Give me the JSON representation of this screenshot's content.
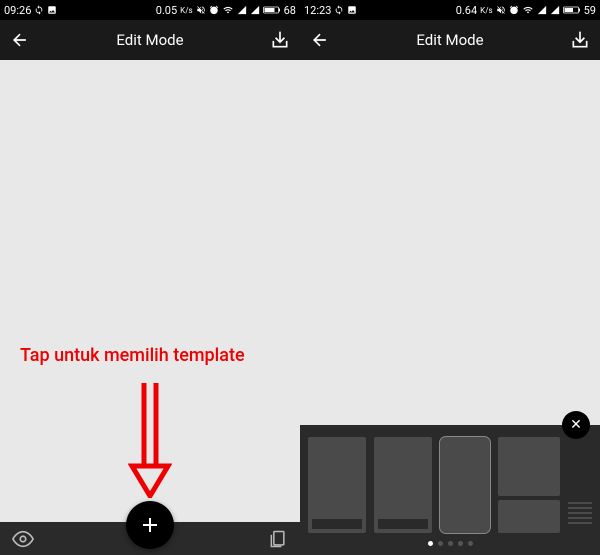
{
  "left_screen": {
    "status": {
      "time": "09:26",
      "net_speed": "0.05",
      "net_unit": "K/s",
      "battery": "68"
    },
    "header": {
      "title": "Edit Mode"
    }
  },
  "right_screen": {
    "status": {
      "time": "12:23",
      "net_speed": "0.64",
      "net_unit": "K/s",
      "battery": "59"
    },
    "header": {
      "title": "Edit Mode"
    },
    "template_panel": {
      "close_label": "✕",
      "page_count": 5,
      "active_page": 0
    }
  },
  "fab": {
    "plus_label": "+"
  },
  "annotation": {
    "text": "Tap untuk memilih template"
  }
}
